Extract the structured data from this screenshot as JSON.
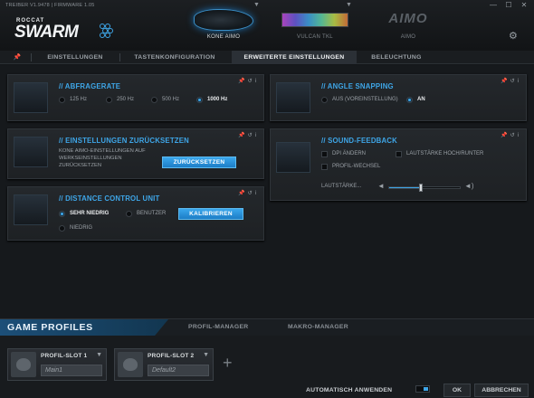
{
  "titlebar": {
    "version": "TREIBER V1.9478 | FIRMWARE 1.05",
    "logo_top": "ROCCAT",
    "logo_main": "SWARM",
    "minimize": "—",
    "maximize": "☐",
    "close": "✕"
  },
  "devices": [
    {
      "label": "KONE AIMO"
    },
    {
      "label": "VULCAN TKL"
    },
    {
      "label": "AIMO",
      "logo_text": "AIMO"
    }
  ],
  "tabs": [
    "EINSTELLUNGEN",
    "TASTENKONFIGURATION",
    "ERWEITERTE EINSTELLUNGEN",
    "BELEUCHTUNG"
  ],
  "icons": {
    "pin": "📌",
    "reset": "↺",
    "info": "i",
    "gear": "⚙",
    "plus": "+",
    "speaker": "🔊",
    "volume_low": "🔈",
    "volume_high": "🔊"
  },
  "polling": {
    "title": "// ABFRAGERATE",
    "options": [
      "125 Hz",
      "250 Hz",
      "500 Hz",
      "1000 Hz"
    ],
    "selected": "1000 Hz"
  },
  "angle": {
    "title": "// ANGLE SNAPPING",
    "options": [
      "AUS (VOREINSTELLUNG)",
      "AN"
    ],
    "selected": "AN"
  },
  "reset": {
    "title": "// EINSTELLUNGEN ZURÜCKSETZEN",
    "description": "KONE AIMO-EINSTELLUNGEN AUF WERKSEINSTELLUNGEN ZURÜCKSETZEN",
    "button": "ZURÜCKSETZEN"
  },
  "sound": {
    "title": "// SOUND-FEEDBACK",
    "checkboxes": [
      "DPI ÄNDERN",
      "LAUTSTÄRKE HOCH/RUNTER",
      "PROFIL-WECHSEL"
    ],
    "volume_label": "LAUTSTÄRKE...",
    "volume": 0.45
  },
  "distance": {
    "title": "// DISTANCE CONTROL UNIT",
    "options": [
      "SEHR NIEDRIG",
      "BENUTZER",
      "NIEDRIG"
    ],
    "selected": "SEHR NIEDRIG",
    "button": "KALIBRIEREN"
  },
  "profiles": {
    "title": "GAME PROFILES",
    "tabs": [
      "PROFIL-MANAGER",
      "MAKRO-MANAGER"
    ],
    "slots": [
      {
        "name": "PROFIL-SLOT 1",
        "value": "Main1"
      },
      {
        "name": "PROFIL-SLOT 2",
        "value": "Default2"
      }
    ]
  },
  "footer": {
    "auto_apply": "AUTOMATISCH ANWENDEN",
    "ok": "OK",
    "cancel": "ABBRECHEN"
  },
  "colors": {
    "accent": "#3ea6e8",
    "background": "#16191c"
  }
}
